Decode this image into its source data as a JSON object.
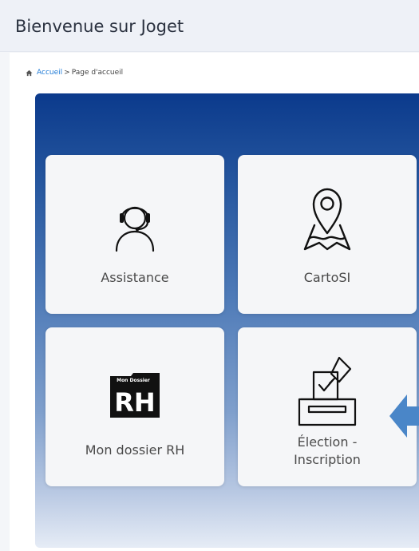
{
  "header": {
    "title": "Bienvenue sur Joget"
  },
  "breadcrumb": {
    "home_icon": "home-icon",
    "home_label": "Accueil",
    "separator": ">",
    "current": "Page d'accueil"
  },
  "tiles": [
    {
      "label": "Assistance",
      "icon": "headset-support-icon"
    },
    {
      "label": "CartoSI",
      "icon": "map-pin-icon"
    },
    {
      "label": "Mon dossier RH",
      "icon": "hr-dossier-icon",
      "icon_text_small": "Mon Dossier",
      "icon_text_big": "RH"
    },
    {
      "label_line1": "Élection -",
      "label_line2": "Inscription",
      "icon": "ballot-box-icon"
    }
  ],
  "colors": {
    "banner_top": "#0b3a8c",
    "banner_bottom": "#e6ecf6",
    "link": "#1e7ad6",
    "arrow": "#4a86c8"
  }
}
